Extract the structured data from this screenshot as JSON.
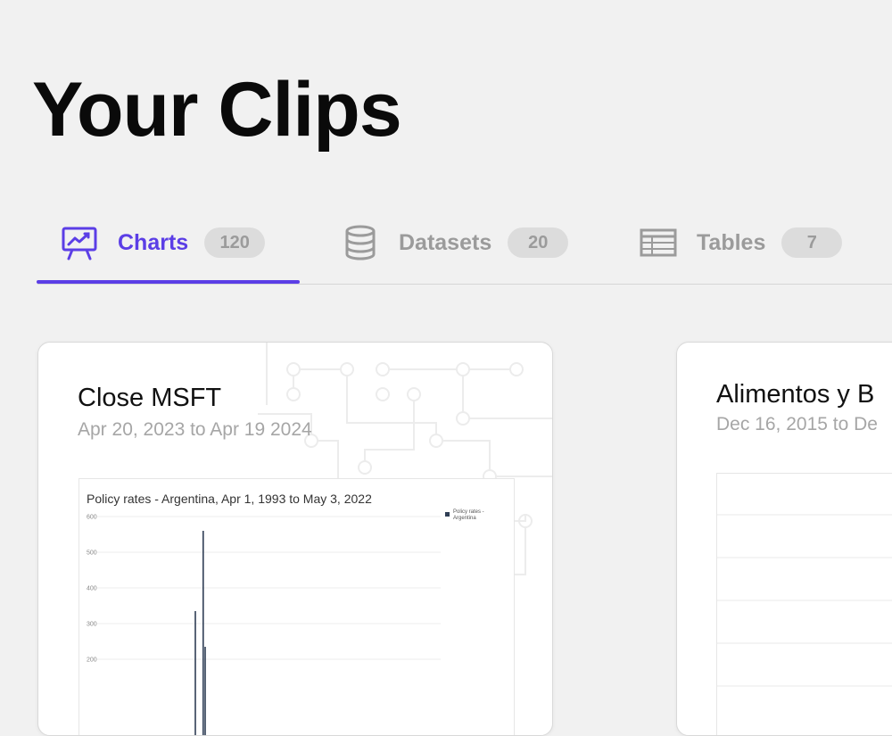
{
  "page": {
    "title": "Your Clips"
  },
  "tabs": [
    {
      "id": "charts",
      "label": "Charts",
      "count": "120",
      "active": true
    },
    {
      "id": "datasets",
      "label": "Datasets",
      "count": "20",
      "active": false
    },
    {
      "id": "tables",
      "label": "Tables",
      "count": "7",
      "active": false
    }
  ],
  "colors": {
    "accent": "#5b3ee6",
    "muted": "#9b9b9b",
    "badge_bg": "#dcdcdc",
    "series": "#2f3e55"
  },
  "icons": {
    "charts": "presentation-chart-icon",
    "datasets": "database-icon",
    "tables": "table-icon"
  },
  "cards": [
    {
      "title": "Close MSFT",
      "subtitle": "Apr 20, 2023 to Apr 19 2024"
    },
    {
      "title": "Alimentos y B",
      "subtitle": "Dec 16, 2015 to De"
    }
  ],
  "chart_data": {
    "type": "bar",
    "title": "Policy rates - Argentina, Apr 1, 1993 to May 3, 2022",
    "series": [
      {
        "name": "Policy rates - Argentina",
        "points": [
          {
            "x": "2001-07",
            "y": 335
          },
          {
            "x": "2002-03",
            "y": 560
          },
          {
            "x": "2002-05",
            "y": 235
          }
        ]
      }
    ],
    "yticks": [
      "600",
      "500",
      "400",
      "300",
      "200"
    ],
    "ylim": [
      0,
      600
    ],
    "grid": true,
    "legend": "top-right"
  }
}
